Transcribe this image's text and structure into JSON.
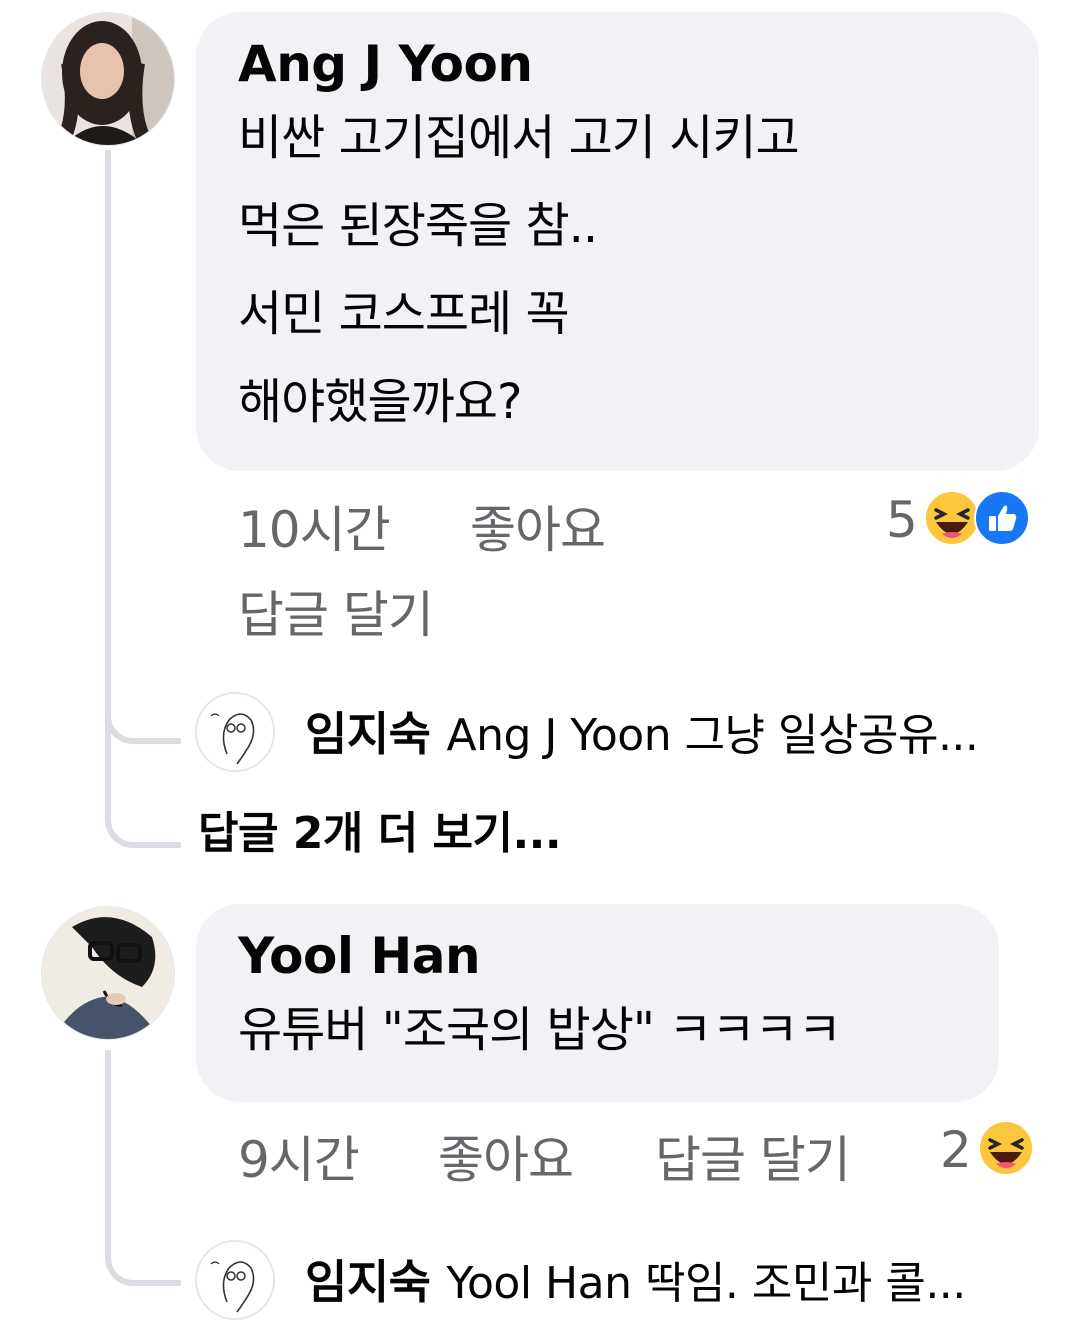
{
  "comments": [
    {
      "author": "Ang J Yoon",
      "text_lines": [
        "비싼 고기집에서 고기 시키고",
        "먹은 된장죽을 참..",
        "서민 코스프레 꼭",
        "해야했을까요?"
      ],
      "time": "10시간",
      "like_label": "좋아요",
      "reply_label": "답글 달기",
      "reaction_count": "5",
      "reactions": [
        "haha-icon",
        "like-icon"
      ],
      "reply_preview": {
        "author": "임지숙",
        "text": "Ang J Yoon 그냥 일상공유..."
      },
      "more_replies": "답글 2개 더 보기..."
    },
    {
      "author": "Yool Han",
      "text_lines": [
        "유튜버 \"조국의 밥상\" ㅋㅋㅋㅋ"
      ],
      "time": "9시간",
      "like_label": "좋아요",
      "reply_label": "답글 달기",
      "reaction_count": "2",
      "reactions": [
        "haha-icon"
      ],
      "reply_preview": {
        "author": "임지숙",
        "text": "Yool Han 딱임. 조민과 콜..."
      }
    }
  ],
  "colors": {
    "bubble": "#f0f2f5",
    "meta": "#65676b",
    "like_blue": "#1877f2",
    "haha_yellow": "#fcc73c"
  }
}
